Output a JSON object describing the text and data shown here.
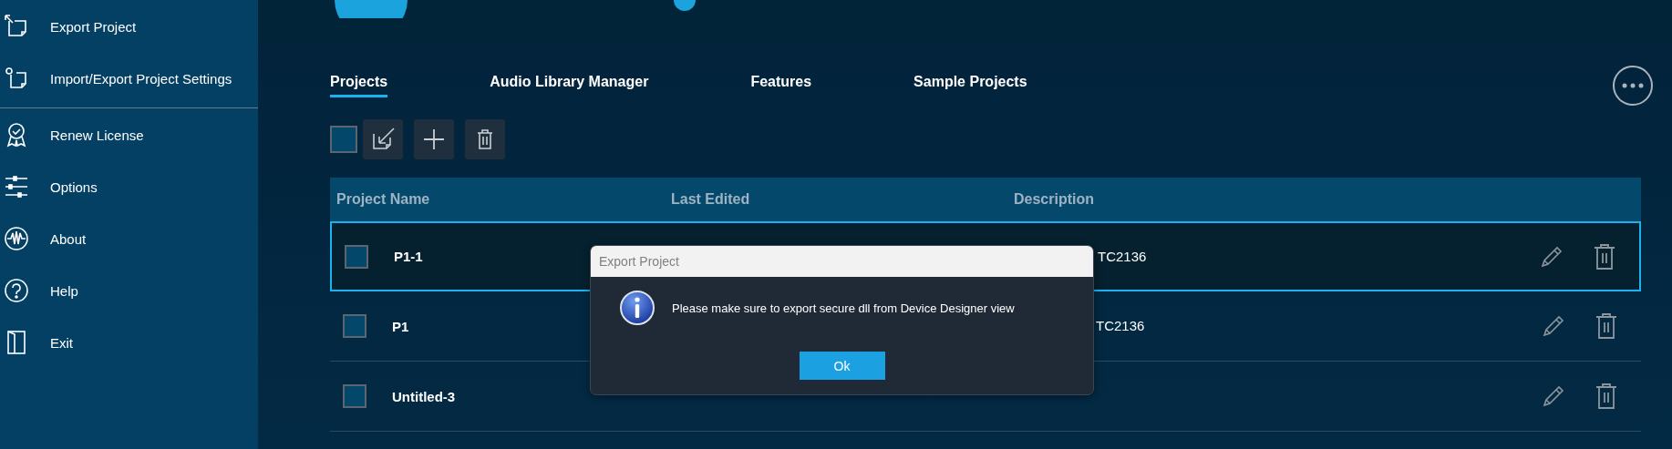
{
  "sidebar": {
    "items": [
      {
        "label": "Export Project"
      },
      {
        "label": "Import/Export Project Settings",
        "divider_after": true
      },
      {
        "label": "Renew License"
      },
      {
        "label": "Options"
      },
      {
        "label": "About"
      },
      {
        "label": "Help"
      },
      {
        "label": "Exit"
      }
    ]
  },
  "tabs": [
    {
      "label": "Projects",
      "selected": true
    },
    {
      "label": "Audio Library Manager",
      "selected": false
    },
    {
      "label": "Features",
      "selected": false
    },
    {
      "label": "Sample Projects",
      "selected": false
    }
  ],
  "toolbar": {
    "select_all_checked": false
  },
  "table": {
    "columns": [
      "Project Name",
      "Last Edited",
      "Description"
    ],
    "rows": [
      {
        "name": "P1-1",
        "description": "TC2136",
        "selected": true,
        "checked": false
      },
      {
        "name": "P1",
        "description": "TC2136",
        "selected": false,
        "checked": false
      },
      {
        "name": "Untitled-3",
        "selected": false,
        "checked": false
      }
    ]
  },
  "dialog": {
    "title": "Export Project",
    "message": "Please make sure to export secure dll from Device Designer view",
    "button": "Ok"
  }
}
